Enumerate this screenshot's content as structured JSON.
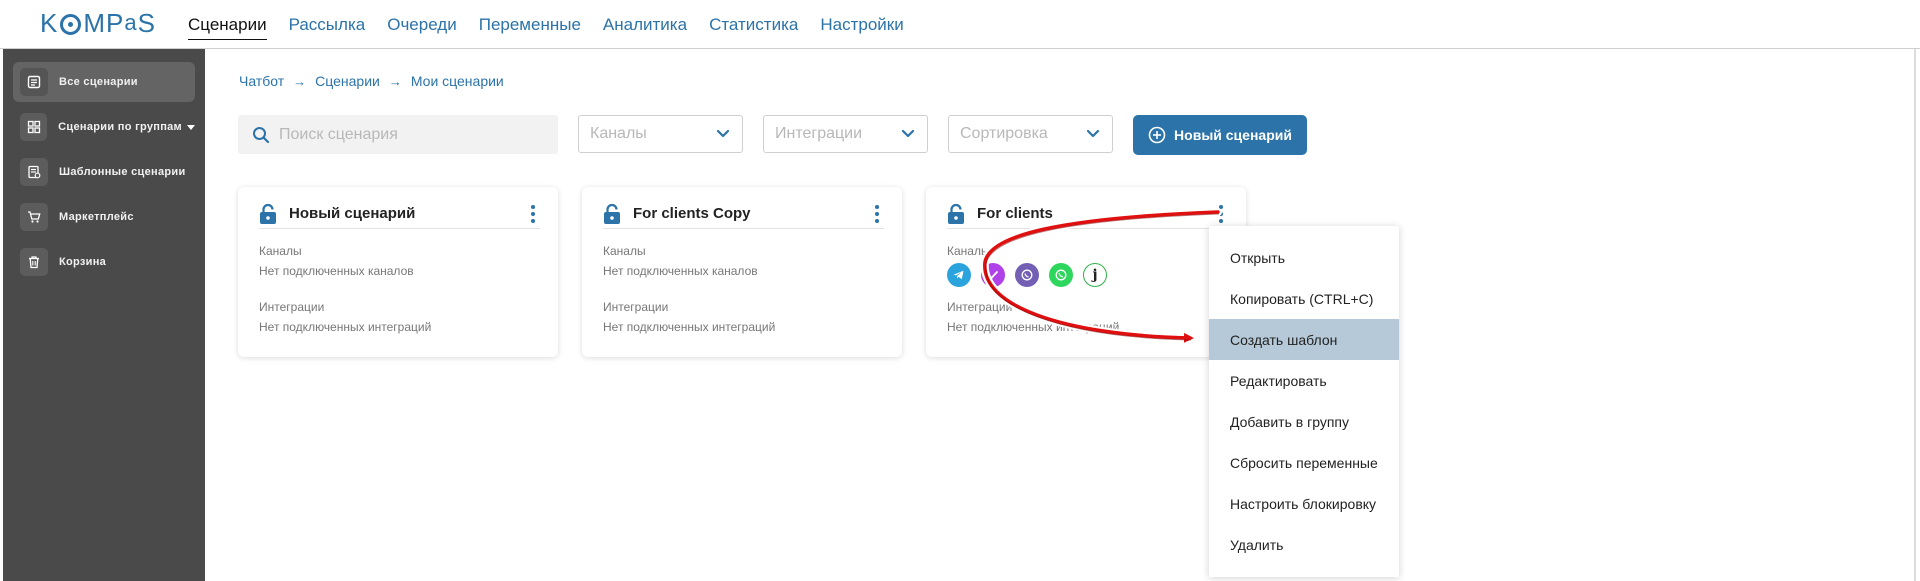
{
  "app": {
    "logo_text": "KOMPaS"
  },
  "nav": {
    "items": [
      "Сценарии",
      "Рассылка",
      "Очереди",
      "Переменные",
      "Аналитика",
      "Статистика",
      "Настройки"
    ],
    "active": "Сценарии"
  },
  "sidebar": {
    "items": [
      {
        "label": "Все сценарии",
        "icon": "list-icon",
        "active": true
      },
      {
        "label": "Сценарии по группам",
        "icon": "grid-icon",
        "has_dropdown": true
      },
      {
        "label": "Шаблонные сценарии",
        "icon": "template-icon"
      },
      {
        "label": "Маркетплейс",
        "icon": "cart-icon"
      },
      {
        "label": "Корзина",
        "icon": "trash-icon"
      }
    ]
  },
  "breadcrumb": [
    "Чатбот",
    "Сценарии",
    "Мои сценарии"
  ],
  "filters": {
    "search_placeholder": "Поиск сценария",
    "channels_placeholder": "Каналы",
    "integrations_placeholder": "Интеграции",
    "sort_placeholder": "Сортировка",
    "new_button": "Новый сценарий"
  },
  "cards": [
    {
      "title": "Новый сценарий",
      "channels_label": "Каналы",
      "channels_value": "Нет подключенных каналов",
      "integrations_label": "Интеграции",
      "integrations_value": "Нет подключенных интеграций"
    },
    {
      "title": "For clients Copy",
      "channels_label": "Каналы",
      "channels_value": "Нет подключенных каналов",
      "integrations_label": "Интеграции",
      "integrations_value": "Нет подключенных интеграций"
    },
    {
      "title": "For clients",
      "channels_label": "Каналы",
      "channel_icons": [
        "telegram-icon",
        "viber-purple-icon",
        "viber-icon",
        "whatsapp-icon",
        "jivo-icon"
      ],
      "integrations_label": "Интеграции",
      "integrations_value": "Нет подключенных интеграций"
    }
  ],
  "context_menu": {
    "items": [
      "Открыть",
      "Копировать (CTRL+C)",
      "Создать шаблон",
      "Редактировать",
      "Добавить в группу",
      "Сбросить переменные",
      "Настроить блокировку",
      "Удалить"
    ],
    "highlighted": "Создать шаблон"
  },
  "colors": {
    "brand": "#2b73a8",
    "sidebar_bg": "#4a4a4a",
    "menu_highlight": "#b5c9d8",
    "annotation_arrow": "#e01010"
  }
}
